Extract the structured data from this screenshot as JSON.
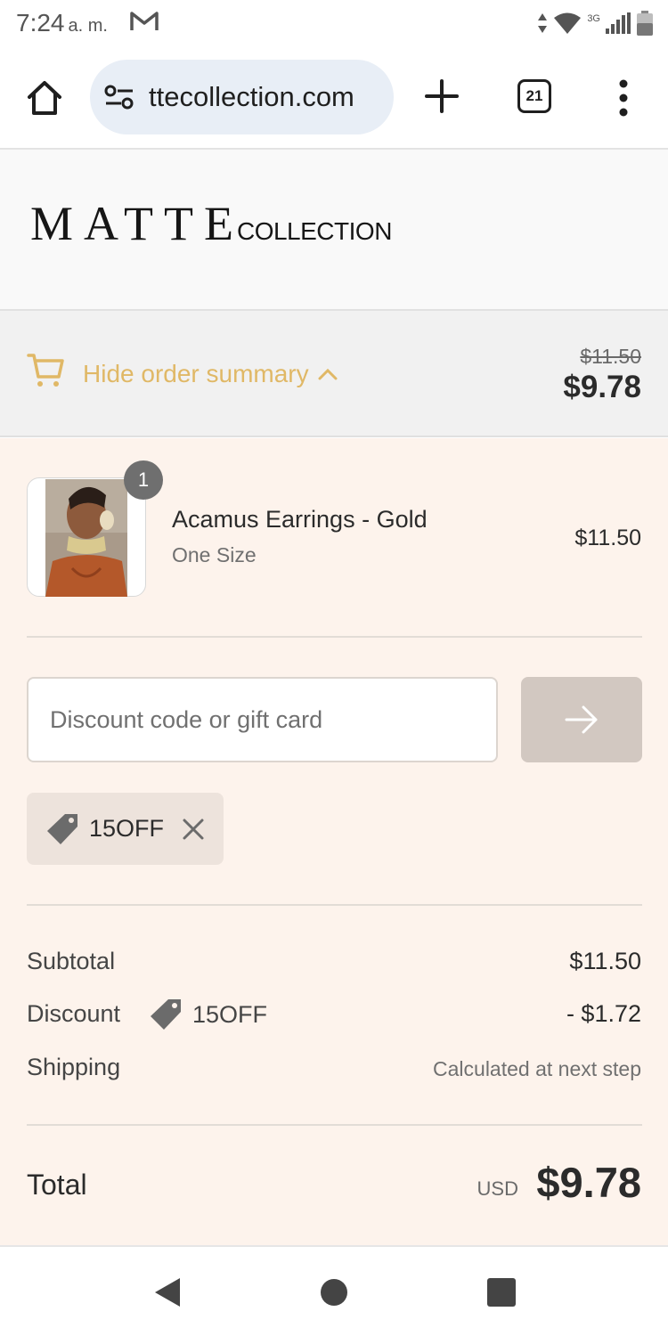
{
  "status_bar": {
    "time": "7:24",
    "ampm": "a. m.",
    "network": "3G"
  },
  "browser": {
    "url": "ttecollection.com",
    "tab_count": "21"
  },
  "store": {
    "logo_main": "MATTE",
    "logo_sub": "COLLECTION"
  },
  "summary_toggle": {
    "label": "Hide order summary",
    "original_price": "$11.50",
    "price": "$9.78"
  },
  "product": {
    "quantity": "1",
    "name": "Acamus Earrings - Gold",
    "variant": "One Size",
    "price": "$11.50"
  },
  "discount_form": {
    "placeholder": "Discount code or gift card",
    "value": ""
  },
  "applied_code": {
    "code": "15OFF"
  },
  "totals": {
    "subtotal_label": "Subtotal",
    "subtotal_value": "$11.50",
    "discount_label": "Discount",
    "discount_code": "15OFF",
    "discount_value": "- $1.72",
    "shipping_label": "Shipping",
    "shipping_value": "Calculated at next step",
    "total_label": "Total",
    "currency": "USD",
    "total_value": "$9.78"
  },
  "colors": {
    "accent": "#e0b866",
    "summary_bg": "#fdf3ec",
    "button_disabled": "#d2c8c1"
  }
}
